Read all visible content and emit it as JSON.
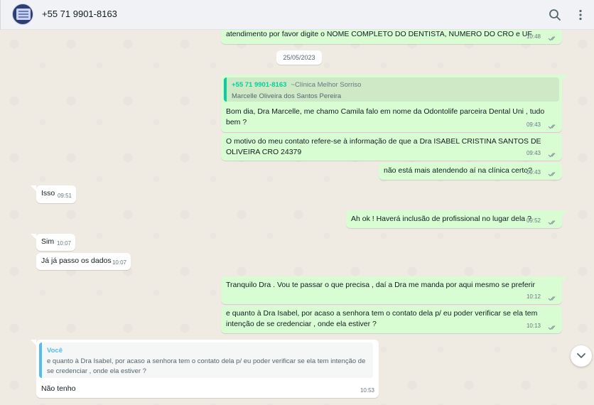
{
  "header": {
    "contact_name": "+55 71 9901-8163",
    "icons": [
      "avatar",
      "search-icon",
      "menu-dots-icon"
    ]
  },
  "date_separator": "25/05/2023",
  "messages": [
    {
      "id": "m0",
      "direction": "out",
      "text": "atendimento por favor digite o NOME COMPLETO DO DENTISTA, NUMERO DO CRO e UF.",
      "time": "10:48"
    },
    {
      "id": "m1",
      "direction": "out",
      "quote": {
        "author": "+55 71 9901-8163",
        "nickname": "~Clínica Melhor Sorriso",
        "text": "Marcelle Oliveira dos Santos Pereira"
      },
      "text_lines": [
        "Bom dia, Dra Marcelle, me chamo Camila falo em nome da Odontolife parceira Dental Uni , tudo",
        "bem ?"
      ],
      "time": "09:43"
    },
    {
      "id": "m2",
      "direction": "out",
      "text_lines": [
        "O motivo do meu contato refere-se à informação de que a Dra ISABEL CRISTINA SANTOS DE",
        "OLIVEIRA  CRO 24379"
      ],
      "time": "09:43"
    },
    {
      "id": "m3",
      "direction": "out",
      "text": "não está mais atendendo aí na clínica certo?",
      "time": "09:43"
    },
    {
      "id": "m4",
      "direction": "in",
      "text": "Isso",
      "time": "09:51"
    },
    {
      "id": "m5",
      "direction": "out",
      "text": "Ah ok ! Haverá inclusão de profissional no lugar dela ?",
      "time": "09:52"
    },
    {
      "id": "m6",
      "direction": "in",
      "text": "Sim",
      "time": "10:07"
    },
    {
      "id": "m7",
      "direction": "in",
      "text": "Já já passo os dados",
      "time": "10:07"
    },
    {
      "id": "m8",
      "direction": "out",
      "text": "Tranquilo Dra . Vou te passar o que precisa , daí a Dra me manda por aqui mesmo se preferir",
      "time": "10:12"
    },
    {
      "id": "m9",
      "direction": "out",
      "text_lines": [
        "e quanto à Dra Isabel, por acaso a senhora tem o contato dela p/ eu poder verificar se ela tem",
        "intenção de se credenciar , onde ela estiver ?"
      ],
      "time": "10:13"
    },
    {
      "id": "m10",
      "direction": "in",
      "quote": {
        "author": "Você",
        "text": "e quanto à Dra Isabel, por acaso a senhora tem o contato dela p/ eu poder verificar se ela tem intenção de se credenciar , onde ela estiver ?"
      },
      "text": "Não tenho",
      "time": "10:53"
    }
  ],
  "colors": {
    "outgoing_bubble": "#d9fdd3",
    "incoming_bubble": "#ffffff",
    "chat_background": "#efeae2",
    "header_background": "#f0f2f5",
    "quote_accent_green": "#06cf9c",
    "quote_accent_blue": "#53bdeb"
  }
}
